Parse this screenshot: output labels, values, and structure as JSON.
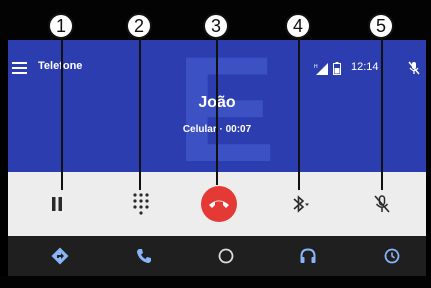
{
  "status_bar": {
    "menu_icon": "menu-icon",
    "app_title": "Telefone",
    "signal_icon": "signal-icon",
    "battery_icon": "battery-icon",
    "time": "12:14",
    "mic_icon": "mic-off-icon"
  },
  "call": {
    "contact_letter": "E",
    "contact_name": "João",
    "status": "Celular · 00:07"
  },
  "controls": [
    {
      "icon": "pause-icon"
    },
    {
      "icon": "dialpad-icon"
    },
    {
      "icon": "end-call-icon",
      "color": "#e53935"
    },
    {
      "icon": "bluetooth-audio-icon"
    },
    {
      "icon": "mic-off-icon"
    }
  ],
  "callouts": [
    "1",
    "2",
    "3",
    "4",
    "5"
  ],
  "nav_bar": [
    {
      "icon": "navigation-icon"
    },
    {
      "icon": "phone-icon"
    },
    {
      "icon": "home-circle-icon"
    },
    {
      "icon": "headphones-icon"
    },
    {
      "icon": "history-icon"
    }
  ],
  "colors": {
    "header_blue": "#2c3db0",
    "controls_bg": "#ededed",
    "nav_bg": "#1f1f1f",
    "end_call_red": "#e53935",
    "nav_icon_blue": "#8ab4f8"
  }
}
